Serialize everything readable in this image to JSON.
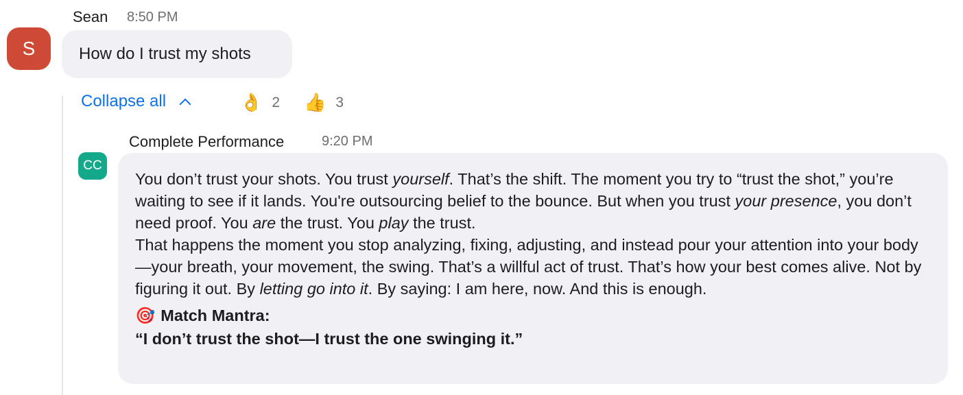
{
  "messages": {
    "sean": {
      "name": "Sean",
      "time": "8:50 PM",
      "avatar_letter": "S",
      "avatar_color": "#cf4a36",
      "text": "How do I trust my shots"
    },
    "reply": {
      "name": "Complete Performance",
      "time": "9:20 PM",
      "avatar_letter": "CC",
      "avatar_color": "#14a98a",
      "para1": {
        "a": "You don’t trust your shots. You trust ",
        "b": "yourself",
        "c": ". That’s the shift. The moment you try to “trust the shot,” you’re waiting to see if it lands. You're outsourcing belief to the bounce. But when you trust ",
        "d": "your presence",
        "e": ", you don’t need proof. You ",
        "f": "are",
        "g": " the trust. You ",
        "h": "play",
        "i": " the trust."
      },
      "para2": {
        "a": "That happens the moment you stop analyzing, fixing, adjusting, and instead pour your attention into your body—your breath, your movement, the swing. That’s a willful act of trust. That’s how your best comes alive. Not by figuring it out. By ",
        "b": "letting go into it",
        "c": ". By saying: I am here, now. And this is enough."
      },
      "mantra_emoji": "🎯",
      "mantra_title": "Match Mantra:",
      "mantra_quote": "“I don’t trust the shot—I trust the one swinging it.”"
    }
  },
  "thread": {
    "collapse_label": "Collapse all",
    "reactions": [
      {
        "emoji": "👌",
        "icon": "ok-hand-icon",
        "count": "2"
      },
      {
        "emoji": "👍",
        "icon": "thumbs-up-icon",
        "count": "3"
      }
    ]
  },
  "colors": {
    "accent": "#0e71eb",
    "bubble_bg": "#f1f1f5",
    "meta_text": "#6e6e73"
  }
}
